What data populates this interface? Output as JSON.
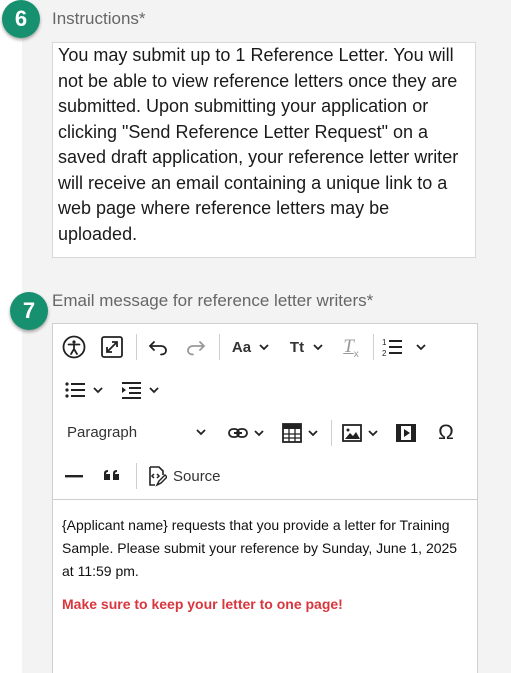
{
  "step6": {
    "number": "6",
    "label": "Instructions*"
  },
  "instructions": {
    "text": "You may submit up to 1 Reference Letter. You will not be able to view reference letters once they are submitted. Upon submitting your application or clicking \"Send Reference Letter Request\" on a saved draft application, your reference letter writer will receive an email containing a unique link to a web page where reference letters may be uploaded."
  },
  "step7": {
    "number": "7",
    "label": "Email message for reference letter writers*"
  },
  "toolbar": {
    "icons": [
      "accessibility-icon",
      "fullscreen-icon",
      "undo-icon",
      "redo-icon",
      "font-size-icon",
      "text-transform-icon",
      "remove-format-icon",
      "numbered-list-icon",
      "bulleted-list-icon",
      "indent-icon",
      "link-icon",
      "table-icon",
      "image-icon",
      "media-icon",
      "special-characters-icon",
      "horizontal-line-icon",
      "blockquote-icon",
      "source-icon"
    ],
    "font_size_label": "Aa",
    "text_transform_label": "Tt",
    "remove_format_label": "T",
    "paragraph_label": "Paragraph",
    "omega_label": "Ω",
    "source_label": "Source"
  },
  "editor": {
    "body": "{Applicant name} requests that you provide a letter for Training Sample. Please submit your reference by Sunday, June 1, 2025 at 11:59 pm.",
    "warning": "Make sure to keep your letter to one page!",
    "warning_color": "#d9363e"
  },
  "colors": {
    "badge": "#16906f",
    "panel": "#f3f3f3"
  }
}
